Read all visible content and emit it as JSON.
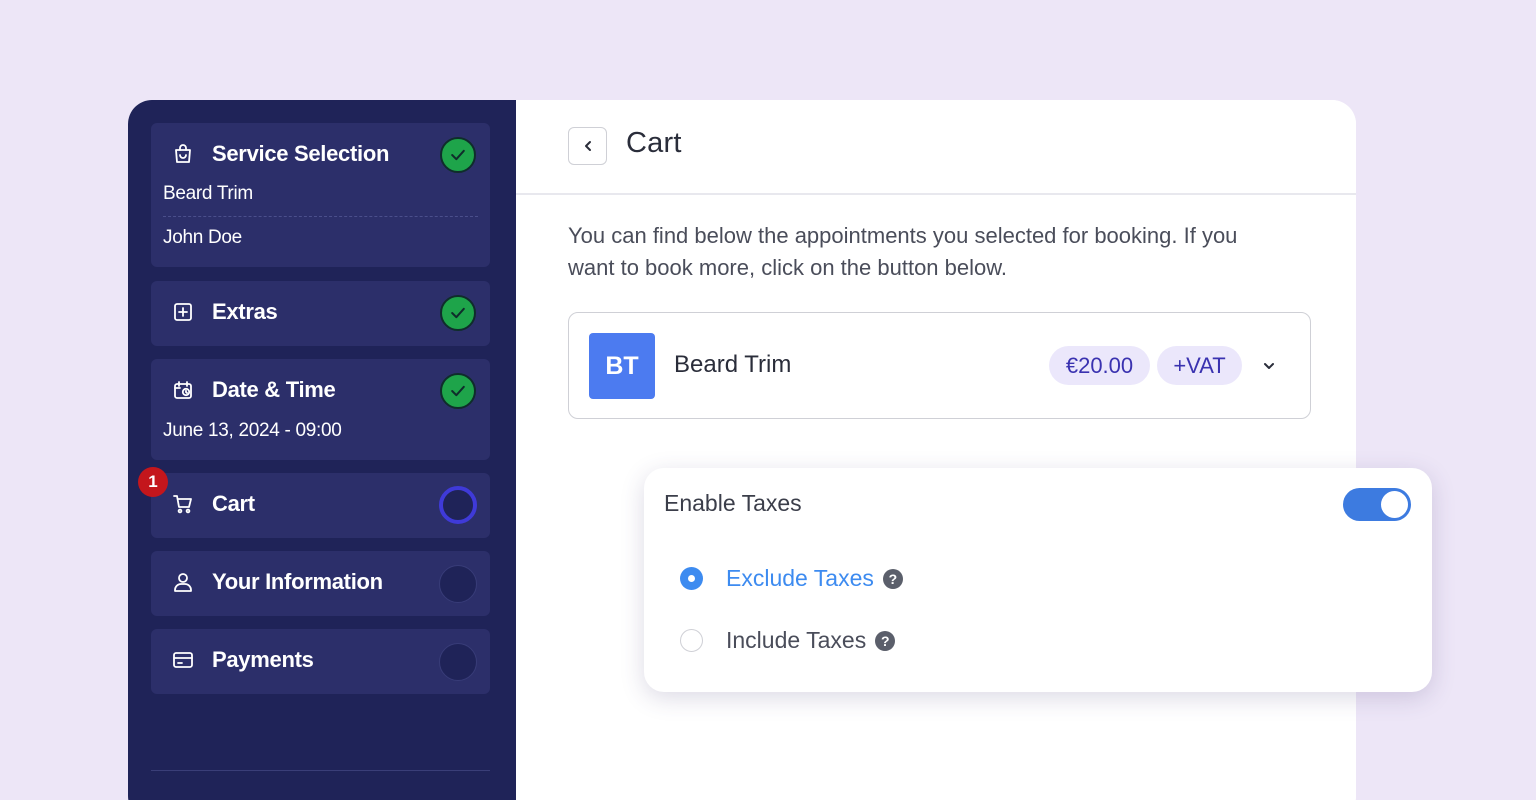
{
  "sidebar": {
    "steps": [
      {
        "title": "Service Selection",
        "status": "completed",
        "details": [
          "Beard Trim",
          "John Doe"
        ],
        "icon": "shopping-bag-icon"
      },
      {
        "title": "Extras",
        "status": "completed",
        "details": [],
        "icon": "plus-square-icon"
      },
      {
        "title": "Date & Time",
        "status": "completed",
        "details": [
          "June 13, 2024 - 09:00"
        ],
        "icon": "calendar-clock-icon"
      },
      {
        "title": "Cart",
        "status": "current",
        "details": [],
        "icon": "cart-icon",
        "badge": "1"
      },
      {
        "title": "Your Information",
        "status": "pending",
        "details": [],
        "icon": "user-icon"
      },
      {
        "title": "Payments",
        "status": "pending",
        "details": [],
        "icon": "credit-card-icon"
      }
    ]
  },
  "main": {
    "title": "Cart",
    "intro": "You can find below the appointments you selected for booking. If you want to book more, click on the button below.",
    "cart_item": {
      "initials": "BT",
      "name": "Beard Trim",
      "price": "€20.00",
      "tax_label": "+VAT",
      "avatar_color": "#4c7bf0"
    }
  },
  "tax_settings": {
    "title": "Enable Taxes",
    "enabled": true,
    "options": [
      {
        "label": "Exclude Taxes",
        "selected": true
      },
      {
        "label": "Include Taxes",
        "selected": false
      }
    ],
    "help_symbol": "?"
  },
  "colors": {
    "sidebar_bg": "#1f2358",
    "step_bg": "#2c2f6a",
    "completed": "#1ea44a",
    "current_ring": "#3f3ad8",
    "accent_blue": "#3d8bf0",
    "badge_red": "#c4161c",
    "page_bg": "#ede6f7"
  }
}
